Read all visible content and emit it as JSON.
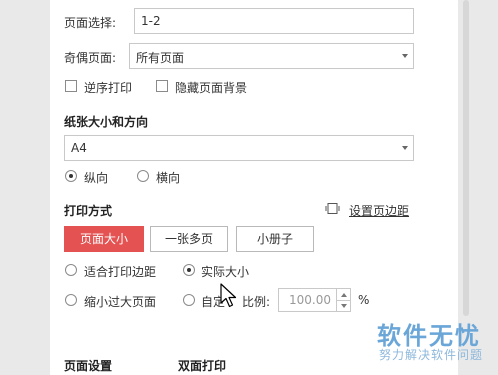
{
  "page_select": {
    "label": "页面选择:",
    "value": "1-2"
  },
  "odd_even": {
    "label": "奇偶页面:",
    "value": "所有页面"
  },
  "reverse_print": {
    "label": "逆序打印",
    "checked": false
  },
  "hide_bg": {
    "label": "隐藏页面背景",
    "checked": false
  },
  "paper": {
    "heading": "纸张大小和方向",
    "size": "A4",
    "portrait": "纵向",
    "landscape": "横向",
    "orientation": "portrait"
  },
  "print_mode": {
    "heading": "打印方式",
    "margin_link": "设置页边距",
    "margin_icon": "page-margin-icon",
    "buttons": [
      "页面大小",
      "一张多页",
      "小册子"
    ],
    "active_button": "页面大小",
    "fit_margins": "适合打印边距",
    "actual_size": "实际大小",
    "shrink_large": "缩小过大页面",
    "custom_scale_prefix": "自定",
    "custom_scale_suffix": "比例:",
    "scale_value": "100.00",
    "percent": "%",
    "selected_option": "实际大小"
  },
  "bottom": {
    "page_settings": "页面设置",
    "duplex": "双面打印"
  },
  "watermark": {
    "title": "软件无忧",
    "subtitle": "努力解决软件问题"
  },
  "colors": {
    "accent": "#e45252",
    "watermark": "#6aa6d8"
  }
}
